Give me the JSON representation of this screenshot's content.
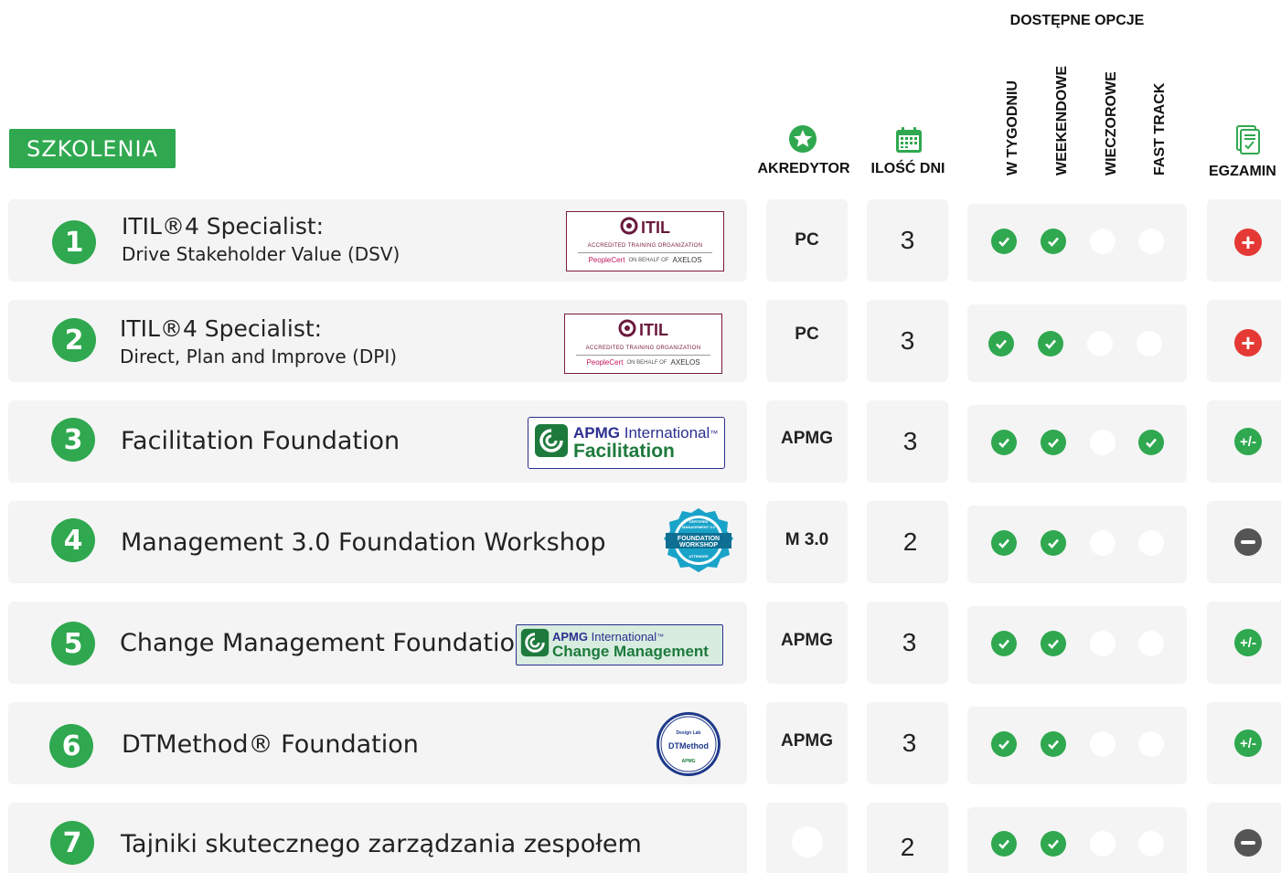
{
  "header": {
    "szkolenia_label": "SZKOLENIA",
    "dostepne_opcje": "DOSTĘPNE OPCJE",
    "akredytor": "AKREDYTOR",
    "ilosc_dni": "ILOŚĆ DNI",
    "w_tygodniu": "W TYGODNIU",
    "weekendowe": "WEEKENDOWE",
    "wieczorowe": "WIECZOROWE",
    "fast_track": "FAST TRACK",
    "egzamin": "EGZAMIN"
  },
  "logos": {
    "itil": {
      "brand": "ITIL",
      "sub": "ACCREDITED TRAINING ORGANIZATION",
      "peoplecert": "PeopleCert",
      "on_behalf": "ON BEHALF OF",
      "axelos": "AXELOS"
    },
    "apmg": {
      "brand_bold": "APMG",
      "brand_rest": " International",
      "tm": "™",
      "facilitation": "Facilitation",
      "change": "Change Management"
    },
    "m30": {
      "line1": "CERTIFIED",
      "line2": "MANAGEMENT 3.0",
      "line3": "FOUNDATION",
      "line4": "WORKSHOP",
      "line5": "ATTENDEE"
    },
    "dt": {
      "line1": "Design Lab",
      "line2": "DTMethod",
      "line3": "APMG"
    }
  },
  "rows": [
    {
      "num": "1",
      "title_l1": "ITIL®4 Specialist:",
      "title_l2": "Drive Stakeholder Value (DSV)",
      "akr": "PC",
      "dni": "3",
      "options": [
        "on",
        "on",
        "off",
        "off"
      ],
      "exam": "plus"
    },
    {
      "num": "2",
      "title_l1": "ITIL®4 Specialist:",
      "title_l2": "Direct, Plan and Improve (DPI)",
      "akr": "PC",
      "dni": "3",
      "options": [
        "on",
        "on",
        "off",
        "off"
      ],
      "exam": "plus"
    },
    {
      "num": "3",
      "title": "Facilitation Foundation",
      "akr": "APMG",
      "dni": "3",
      "options": [
        "on",
        "on",
        "off",
        "on"
      ],
      "exam": "pm"
    },
    {
      "num": "4",
      "title": "Management 3.0 Foundation Workshop",
      "akr": "M 3.0",
      "dni": "2",
      "options": [
        "on",
        "on",
        "off",
        "off"
      ],
      "exam": "minus"
    },
    {
      "num": "5",
      "title": "Change Management Foundation",
      "akr": "APMG",
      "dni": "3",
      "options": [
        "on",
        "on",
        "off",
        "off"
      ],
      "exam": "pm"
    },
    {
      "num": "6",
      "title": "DTMethod® Foundation",
      "akr": "APMG",
      "dni": "3",
      "options": [
        "on",
        "on",
        "off",
        "off"
      ],
      "exam": "pm"
    },
    {
      "num": "7",
      "title": "Tajniki skutecznego zarządzania zespołem",
      "akr": "",
      "dni": "2",
      "options": [
        "on",
        "on",
        "off",
        "off"
      ],
      "exam": "minus"
    }
  ],
  "exam_symbols": {
    "plus": "+",
    "pm": "+/-"
  },
  "colors": {
    "green": "#2fa84f",
    "red": "#e53935",
    "gray": "#555555",
    "itil_purple": "#6a1a3c",
    "apmg_blue": "#2c2f8f"
  }
}
